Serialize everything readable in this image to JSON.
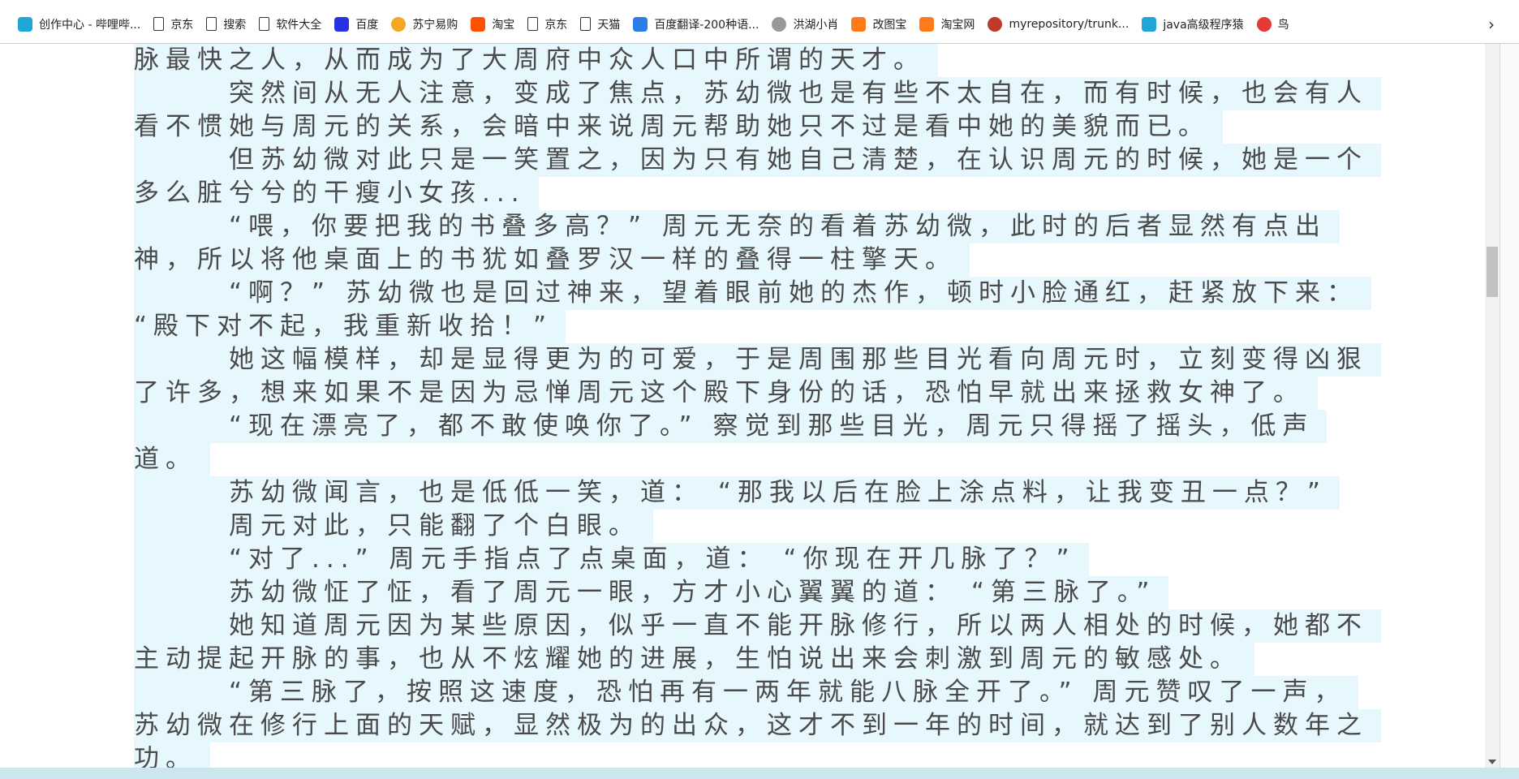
{
  "bookmarks": [
    {
      "label": "创作中心 - 哔哩哔...",
      "icon": "bilibili-icon",
      "color": "#1fa5d6"
    },
    {
      "label": "京东",
      "icon": "page-icon"
    },
    {
      "label": "搜索",
      "icon": "page-icon"
    },
    {
      "label": "软件大全",
      "icon": "page-icon"
    },
    {
      "label": "百度",
      "icon": "baidu-paw-icon",
      "color": "#2932e1"
    },
    {
      "label": "苏宁易购",
      "icon": "suning-lion-icon",
      "color": "#f5a623"
    },
    {
      "label": "淘宝",
      "icon": "taobao-icon",
      "color": "#ff5000"
    },
    {
      "label": "京东",
      "icon": "page-icon"
    },
    {
      "label": "天猫",
      "icon": "page-icon"
    },
    {
      "label": "百度翻译-200种语...",
      "icon": "baidu-translate-icon",
      "color": "#2b7de9"
    },
    {
      "label": "洪湖小肖",
      "icon": "bird-icon",
      "color": "#999999"
    },
    {
      "label": "改图宝",
      "icon": "gaitubao-icon",
      "color": "#ff7a1a"
    },
    {
      "label": "淘宝网",
      "icon": "taobao-icon",
      "color": "#ff7a1a"
    },
    {
      "label": "myrepository/trunk...",
      "icon": "repository-icon",
      "color": "#c0392b"
    },
    {
      "label": "java高级程序猿",
      "icon": "bilibili-icon",
      "color": "#1fa5d6"
    },
    {
      "label": "鸟",
      "icon": "red-bird-icon",
      "color": "#e53935"
    }
  ],
  "more_label": "›",
  "lines": [
    {
      "text": "脉最快之人，从而成为了大周府中众人口中所谓的天才。",
      "indent": false
    },
    {
      "text": "突然间从无人注意，变成了焦点，苏幼微也是有些不太自在，而有时候，也会有人",
      "indent": true
    },
    {
      "text": "看不惯她与周元的关系，会暗中来说周元帮助她只不过是看中她的美貌而已。",
      "indent": false
    },
    {
      "text": "但苏幼微对此只是一笑置之，因为只有她自己清楚，在认识周元的时候，她是一个",
      "indent": true
    },
    {
      "text": "多么脏兮兮的干瘦小女孩...",
      "indent": false
    },
    {
      "text": " “喂，你要把我的书叠多高？” 周元无奈的看着苏幼微，此时的后者显然有点出",
      "indent": true
    },
    {
      "text": "神，所以将他桌面上的书犹如叠罗汉一样的叠得一柱擎天。",
      "indent": false
    },
    {
      "text": " “啊？” 苏幼微也是回过神来，望着眼前她的杰作，顿时小脸通红，赶紧放下来：",
      "indent": true
    },
    {
      "text": "“殿下对不起，我重新收拾！”",
      "indent": false
    },
    {
      "text": "她这幅模样，却是显得更为的可爱，于是周围那些目光看向周元时，立刻变得凶狠",
      "indent": true
    },
    {
      "text": "了许多，想来如果不是因为忌惮周元这个殿下身份的话，恐怕早就出来拯救女神了。",
      "indent": false
    },
    {
      "text": " “现在漂亮了，都不敢使唤你了。” 察觉到那些目光，周元只得摇了摇头，低声",
      "indent": true
    },
    {
      "text": "道。",
      "indent": false
    },
    {
      "text": "苏幼微闻言，也是低低一笑，道： “那我以后在脸上涂点料，让我变丑一点？”",
      "indent": true
    },
    {
      "text": "周元对此，只能翻了个白眼。",
      "indent": true
    },
    {
      "text": " “对了...” 周元手指点了点桌面，道： “你现在开几脉了？”",
      "indent": true
    },
    {
      "text": "苏幼微怔了怔，看了周元一眼，方才小心翼翼的道： “第三脉了。”",
      "indent": true
    },
    {
      "text": "她知道周元因为某些原因，似乎一直不能开脉修行，所以两人相处的时候，她都不",
      "indent": true
    },
    {
      "text": "主动提起开脉的事，也从不炫耀她的进展，生怕说出来会刺激到周元的敏感处。",
      "indent": false
    },
    {
      "text": " “第三脉了，按照这速度，恐怕再有一两年就能八脉全开了。” 周元赞叹了一声，",
      "indent": true
    },
    {
      "text": "苏幼微在修行上面的天赋，显然极为的出众，这才不到一年的时间，就达到了别人数年之",
      "indent": false
    },
    {
      "text": "功。",
      "indent": false
    }
  ],
  "colors": {
    "selection": "#e6f8fe",
    "text": "#4a4a4a",
    "taskbar": "#cbe6ec"
  }
}
